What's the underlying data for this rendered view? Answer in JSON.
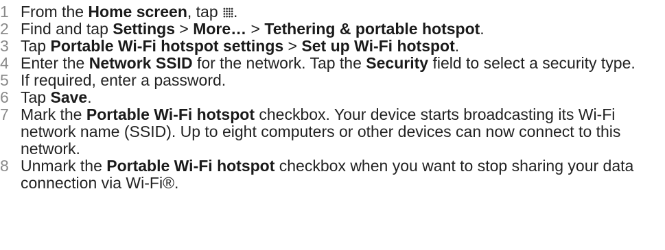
{
  "steps": [
    {
      "num": "1",
      "pre": "From the ",
      "b1": "Home screen",
      "post1": ", tap ",
      "icon": "apps-grid-icon",
      "tail": "."
    },
    {
      "num": "2",
      "pre": "Find and tap ",
      "b1": "Settings",
      "sep1": " > ",
      "b2": "More…",
      "sep2": " > ",
      "b3": "Tethering & portable hotspot",
      "tail": "."
    },
    {
      "num": "3",
      "pre": "Tap ",
      "b1": "Portable Wi-Fi hotspot settings",
      "sep1": " > ",
      "b2": "Set up Wi-Fi hotspot",
      "tail": "."
    },
    {
      "num": "4",
      "pre": "Enter the ",
      "b1": "Network SSID",
      "mid": " for the network. Tap the ",
      "b2": "Security",
      "tail": " field to select a security type."
    },
    {
      "num": "5",
      "text": "If required, enter a password."
    },
    {
      "num": "6",
      "pre": "Tap ",
      "b1": "Save",
      "tail": "."
    },
    {
      "num": "7",
      "pre": "Mark the ",
      "b1": "Portable Wi-Fi hotspot",
      "tail": " checkbox. Your device starts broadcasting its Wi-Fi network name (SSID). Up to eight computers or other devices can now connect to this network."
    },
    {
      "num": "8",
      "pre": "Unmark the ",
      "b1": "Portable Wi-Fi hotspot",
      "tail": " checkbox when you want to stop sharing your data connection via Wi-Fi®."
    }
  ]
}
